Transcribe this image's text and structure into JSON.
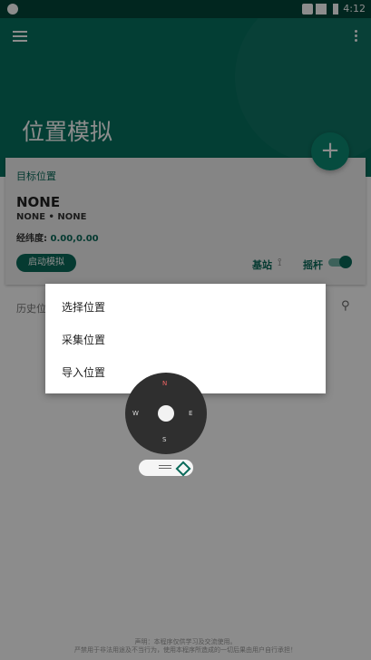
{
  "status_bar": {
    "time": "4:12"
  },
  "appbar": {
    "title": "位置模拟"
  },
  "card": {
    "target_label": "目标位置",
    "name": "NONE",
    "sub": "NONE • NONE",
    "coord_label": "经纬度:",
    "coord_value": "0.00,0.00",
    "start_button": "启动模拟",
    "base_station_label": "基站",
    "joystick_label": "摇杆",
    "joystick_toggle_on": true
  },
  "history": {
    "label": "历史位"
  },
  "menu": {
    "items": [
      {
        "label": "选择位置"
      },
      {
        "label": "采集位置"
      },
      {
        "label": "导入位置"
      }
    ]
  },
  "joystick": {
    "n": "N",
    "s": "S",
    "w": "W",
    "e": "E"
  },
  "footer": {
    "line1": "声明：本程序仅供学习及交流使用。",
    "line2": "严禁用于非法用途及不当行为，使用本程序所造成的一切后果由用户自行承担！"
  },
  "colors": {
    "appbar": "#06715f",
    "status_bar": "#02453a",
    "accent": "#0a6a5a",
    "fab": "#0b8a73",
    "scrim": "rgba(0,0,0,0.45)"
  },
  "icons": [
    "menu-icon",
    "more-vert-icon",
    "add-icon",
    "antenna-icon",
    "search-icon",
    "drag-handle-icon",
    "diamond-icon"
  ]
}
